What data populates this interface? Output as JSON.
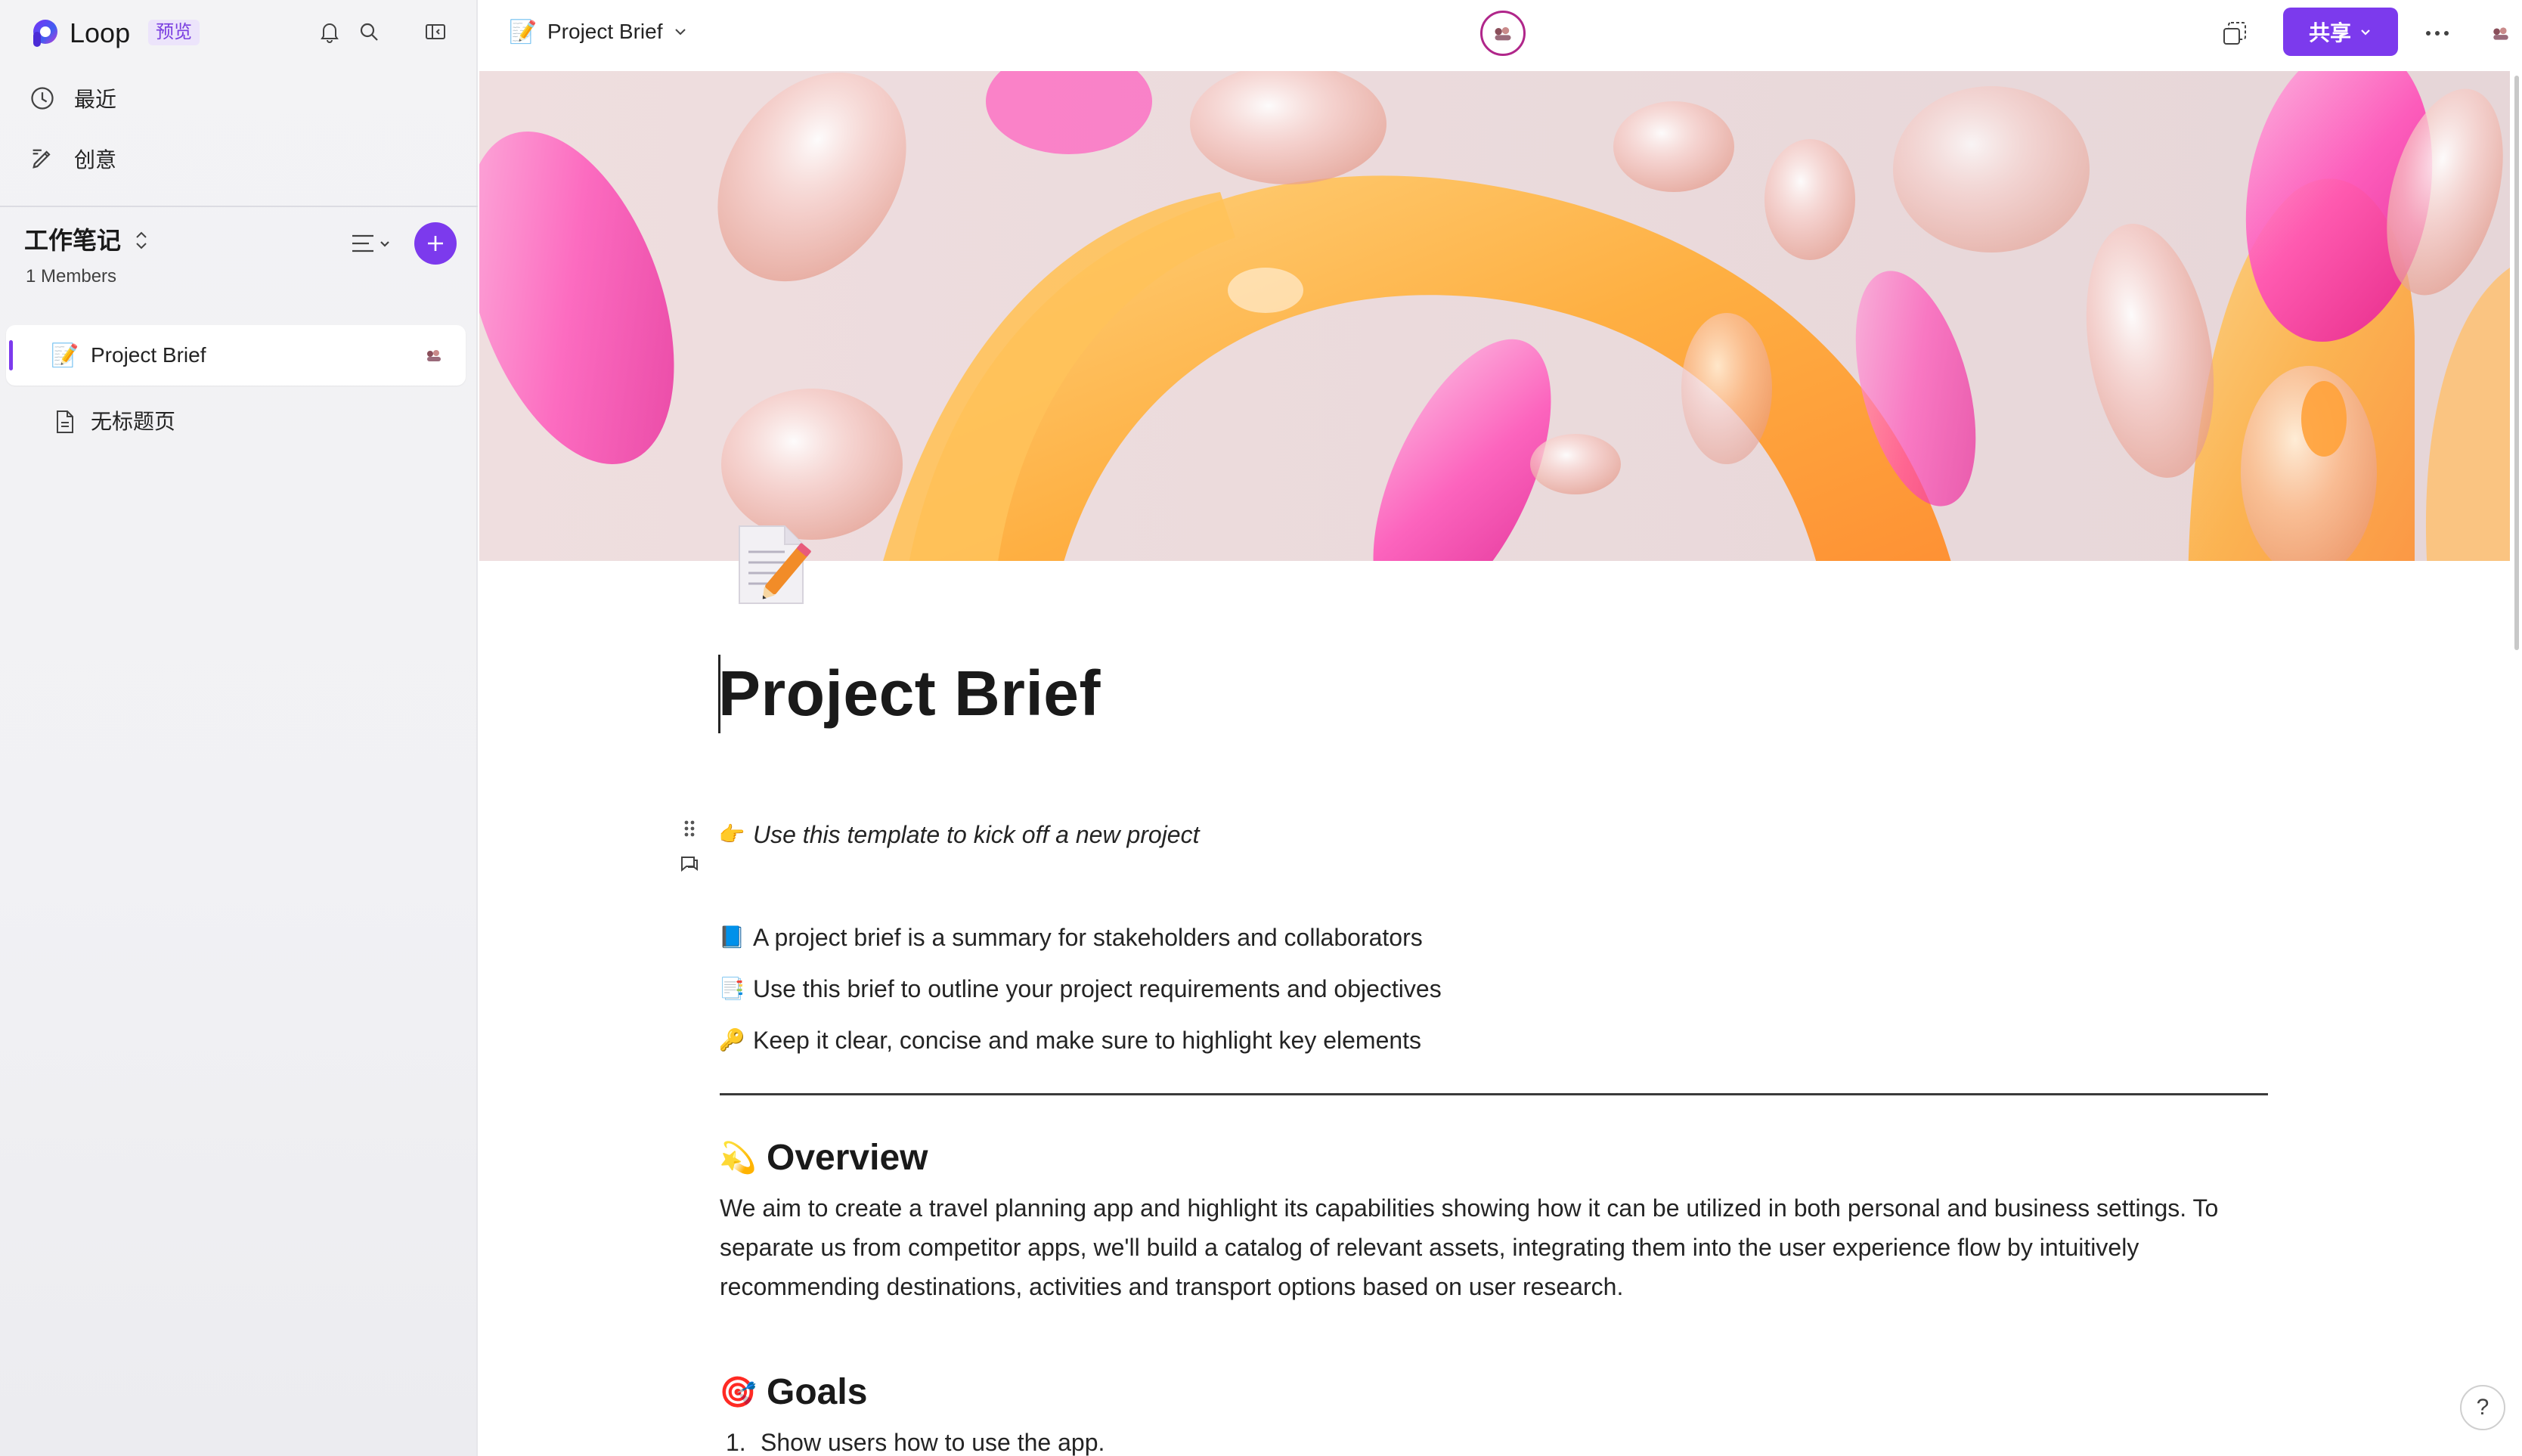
{
  "app": {
    "name": "Loop",
    "badge": "预览"
  },
  "sidebar": {
    "nav": [
      {
        "label": "最近",
        "icon": "clock-icon"
      },
      {
        "label": "创意",
        "icon": "pen-icon"
      }
    ],
    "workspace": {
      "title": "工作笔记",
      "members": "1 Members"
    },
    "pages": [
      {
        "label": "Project Brief",
        "icon": "memo-icon",
        "active": true
      },
      {
        "label": "无标题页",
        "icon": "document-icon",
        "active": false
      }
    ]
  },
  "topbar": {
    "breadcrumb": "Project Brief",
    "share_label": "共享"
  },
  "doc": {
    "title": "Project Brief",
    "callout": "Use this template to kick off a new project",
    "bullets": [
      {
        "emoji": "📘",
        "text": "A project brief is a summary for stakeholders and collaborators"
      },
      {
        "emoji": "📑",
        "text": "Use this brief to outline your project requirements and objectives"
      },
      {
        "emoji": "🔑",
        "text": "Keep it clear, concise and make sure to highlight key elements"
      }
    ],
    "overview": {
      "heading": "Overview",
      "emoji": "💫",
      "body": "We aim to create a travel planning app and highlight its capabilities showing how it can be utilized in both personal and business settings. To separate us from competitor apps, we'll build a catalog of relevant assets, integrating them into the user experience flow by intuitively recommending destinations, activities and transport options based on user research."
    },
    "goals": {
      "heading": "Goals",
      "emoji": "🎯",
      "items": [
        {
          "num": "1.",
          "text": "Show users how to use the app."
        }
      ]
    }
  },
  "help_label": "?",
  "colors": {
    "accent": "#7c3aed",
    "presence_ring": "#b0268a"
  }
}
